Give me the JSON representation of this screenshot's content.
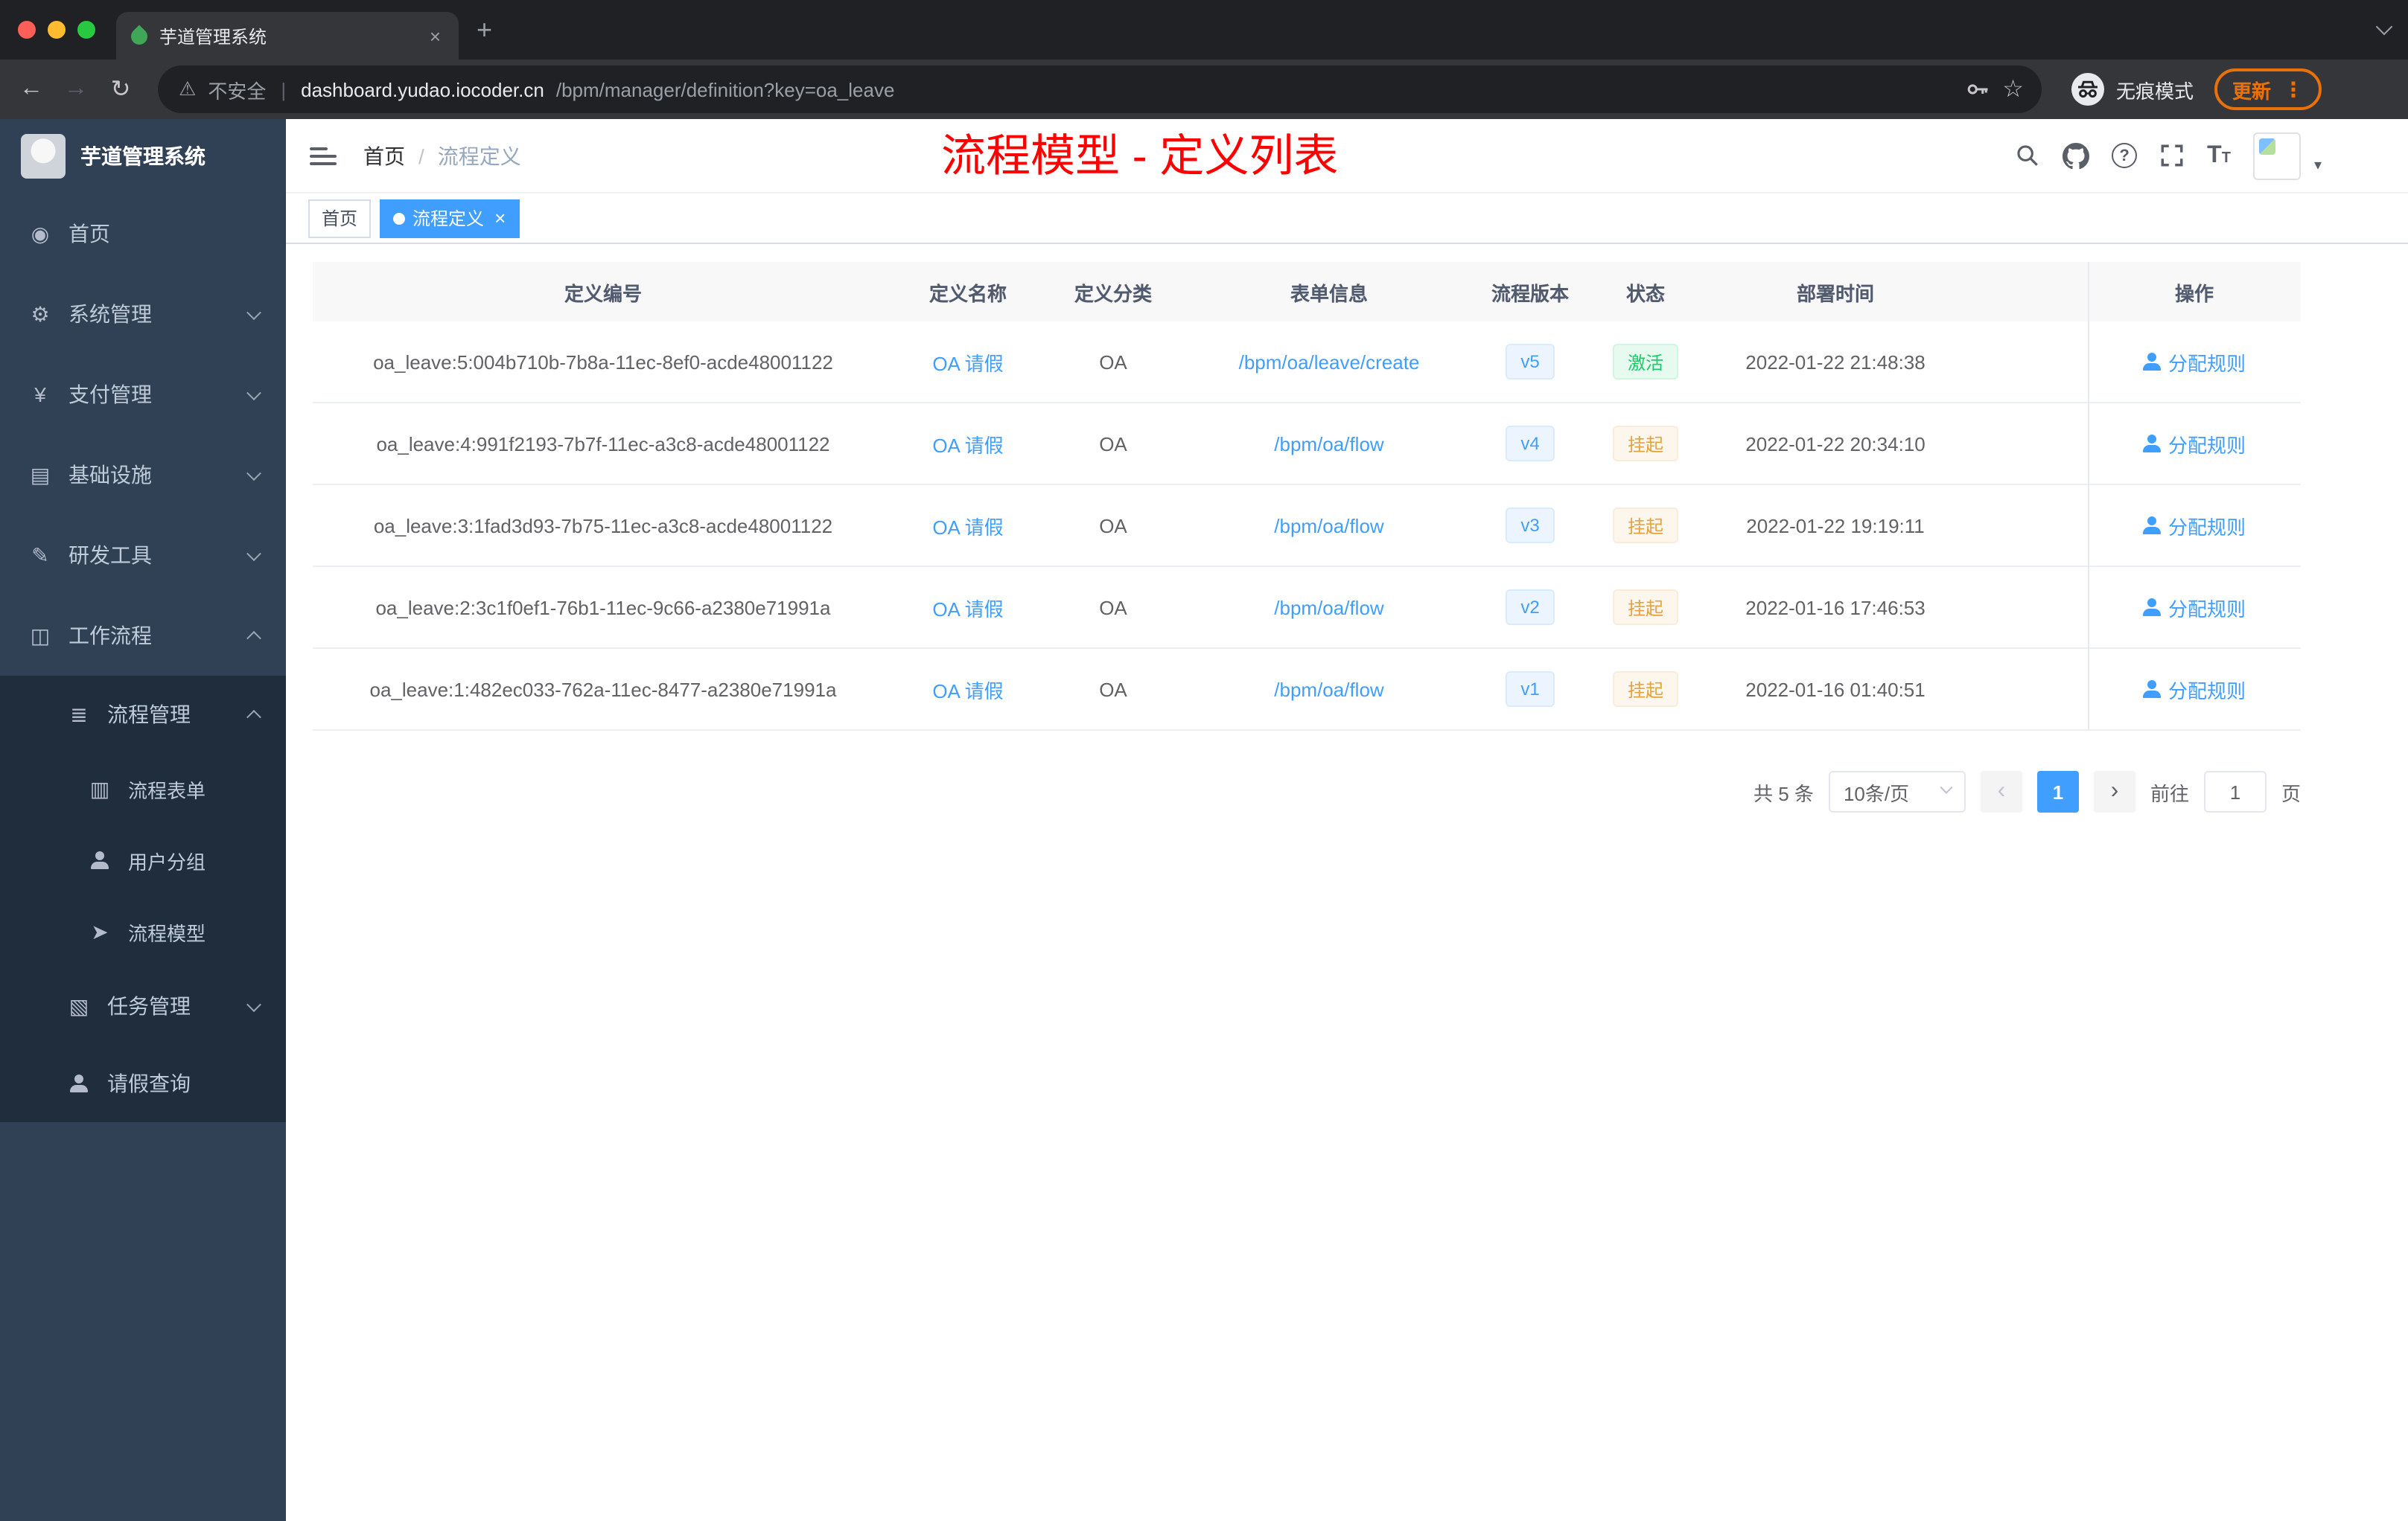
{
  "browser": {
    "traffic_lights": [
      "#ff5f57",
      "#febc2e",
      "#28c840"
    ],
    "tab_title": "芋道管理系统",
    "security_label": "不安全",
    "url_domain": "dashboard.yudao.iocoder.cn",
    "url_path": "/bpm/manager/definition?key=oa_leave",
    "incognito_label": "无痕模式",
    "update_label": "更新"
  },
  "sidebar": {
    "logo_title": "芋道管理系统",
    "menu": [
      {
        "key": "home",
        "label": "首页",
        "icon": "home-icon",
        "level": 1,
        "sub": false
      },
      {
        "key": "system",
        "label": "系统管理",
        "icon": "gear-icon",
        "level": 1,
        "sub": false,
        "arrow": "down"
      },
      {
        "key": "payment",
        "label": "支付管理",
        "icon": "yen-icon",
        "level": 1,
        "sub": false,
        "arrow": "down"
      },
      {
        "key": "infrastructure",
        "label": "基础设施",
        "icon": "infra-icon",
        "level": 1,
        "sub": false,
        "arrow": "down"
      },
      {
        "key": "devtools",
        "label": "研发工具",
        "icon": "tools-icon",
        "level": 1,
        "sub": false,
        "arrow": "down"
      },
      {
        "key": "workflow",
        "label": "工作流程",
        "icon": "workflow-icon",
        "level": 1,
        "sub": false,
        "arrow": "up"
      },
      {
        "key": "process-mgmt",
        "label": "流程管理",
        "icon": "process-icon",
        "level": 2,
        "sub": true,
        "arrow": "up"
      },
      {
        "key": "process-form",
        "label": "流程表单",
        "icon": "form-icon",
        "level": 3,
        "sub": true
      },
      {
        "key": "user-group",
        "label": "用户分组",
        "icon": "users-icon",
        "level": 3,
        "sub": true
      },
      {
        "key": "process-model",
        "label": "流程模型",
        "icon": "model-icon",
        "level": 3,
        "sub": true
      },
      {
        "key": "task-mgmt",
        "label": "任务管理",
        "icon": "task-icon",
        "level": 2,
        "sub": true,
        "arrow": "down"
      },
      {
        "key": "leave-query",
        "label": "请假查询",
        "icon": "person-icon",
        "level": 2,
        "sub": true
      }
    ]
  },
  "header": {
    "breadcrumb": [
      "首页",
      "流程定义"
    ],
    "annotation": "流程模型 - 定义列表"
  },
  "tags": [
    {
      "label": "首页",
      "active": false,
      "closable": false
    },
    {
      "label": "流程定义",
      "active": true,
      "closable": true
    }
  ],
  "table": {
    "columns": [
      "定义编号",
      "定义名称",
      "定义分类",
      "表单信息",
      "流程版本",
      "状态",
      "部署时间",
      "操作"
    ],
    "action_label": "分配规则",
    "rows": [
      {
        "id": "oa_leave:5:004b710b-7b8a-11ec-8ef0-acde48001122",
        "name": "OA 请假",
        "category": "OA",
        "form": "/bpm/oa/leave/create",
        "version": "v5",
        "status": "激活",
        "status_type": "success",
        "time": "2022-01-22 21:48:38"
      },
      {
        "id": "oa_leave:4:991f2193-7b7f-11ec-a3c8-acde48001122",
        "name": "OA 请假",
        "category": "OA",
        "form": "/bpm/oa/flow",
        "version": "v4",
        "status": "挂起",
        "status_type": "warning",
        "time": "2022-01-22 20:34:10"
      },
      {
        "id": "oa_leave:3:1fad3d93-7b75-11ec-a3c8-acde48001122",
        "name": "OA 请假",
        "category": "OA",
        "form": "/bpm/oa/flow",
        "version": "v3",
        "status": "挂起",
        "status_type": "warning",
        "time": "2022-01-22 19:19:11"
      },
      {
        "id": "oa_leave:2:3c1f0ef1-76b1-11ec-9c66-a2380e71991a",
        "name": "OA 请假",
        "category": "OA",
        "form": "/bpm/oa/flow",
        "version": "v2",
        "status": "挂起",
        "status_type": "warning",
        "time": "2022-01-16 17:46:53"
      },
      {
        "id": "oa_leave:1:482ec033-762a-11ec-8477-a2380e71991a",
        "name": "OA 请假",
        "category": "OA",
        "form": "/bpm/oa/flow",
        "version": "v1",
        "status": "挂起",
        "status_type": "warning",
        "time": "2022-01-16 01:40:51"
      }
    ]
  },
  "pagination": {
    "total": "共 5 条",
    "page_size": "10条/页",
    "current_page": "1",
    "goto_label": "前往",
    "goto_value": "1",
    "page_unit": "页"
  },
  "colors": {
    "accent": "#409eff",
    "annotation_red": "#ff0000",
    "success_green": "#13ce66",
    "warning_orange": "#e6a23c",
    "sidebar_bg": "#304156",
    "submenu_bg": "#1f2d3d"
  }
}
